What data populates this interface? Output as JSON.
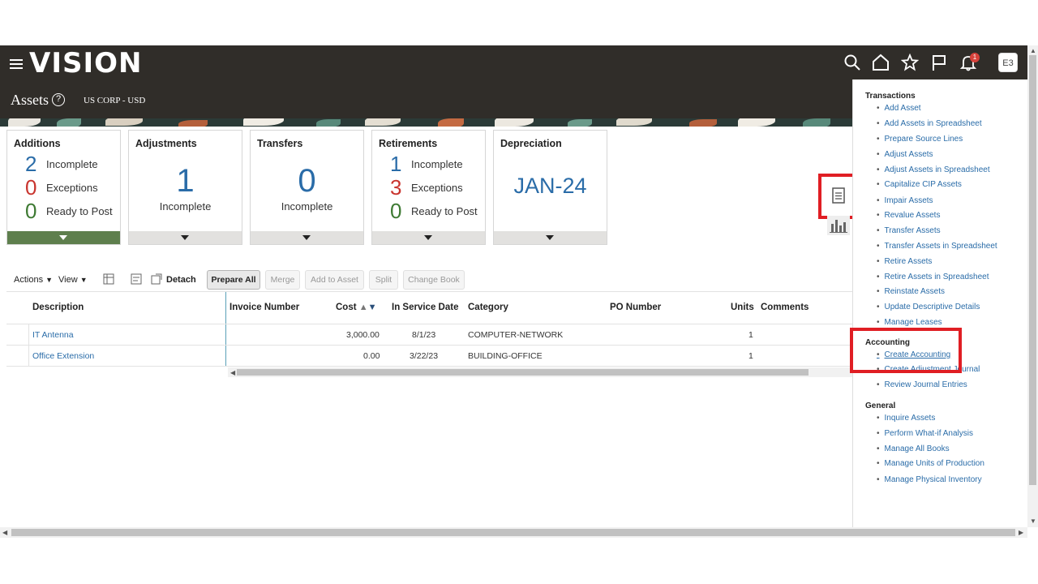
{
  "header": {
    "logo": "vision",
    "page_title": "Assets",
    "help": "?",
    "context": "US CORP - USD",
    "avatar": "E3",
    "notification_count": "1"
  },
  "cards": {
    "additions": {
      "title": "Additions",
      "rows": [
        {
          "num": "2",
          "label": "Incomplete"
        },
        {
          "num": "0",
          "label": "Exceptions"
        },
        {
          "num": "0",
          "label": "Ready to Post"
        }
      ]
    },
    "adjustments": {
      "title": "Adjustments",
      "num": "1",
      "label": "Incomplete"
    },
    "transfers": {
      "title": "Transfers",
      "num": "0",
      "label": "Incomplete"
    },
    "retirements": {
      "title": "Retirements",
      "rows": [
        {
          "num": "1",
          "label": "Incomplete"
        },
        {
          "num": "3",
          "label": "Exceptions"
        },
        {
          "num": "0",
          "label": "Ready to Post"
        }
      ]
    },
    "depreciation": {
      "title": "Depreciation",
      "period": "JAN-24"
    }
  },
  "toolbar": {
    "actions": "Actions",
    "view": "View",
    "detach": "Detach",
    "prepare_all": "Prepare All",
    "merge": "Merge",
    "add_to_asset": "Add to Asset",
    "split": "Split",
    "change_book": "Change Book"
  },
  "table": {
    "headers": {
      "description": "Description",
      "invoice": "Invoice Number",
      "cost": "Cost",
      "in_service": "In Service Date",
      "category": "Category",
      "po": "PO Number",
      "units": "Units",
      "comments": "Comments"
    },
    "rows": [
      {
        "description": "IT Antenna",
        "cost": "3,000.00",
        "date": "8/1/23",
        "category": "COMPUTER-NETWORK",
        "units": "1"
      },
      {
        "description": "Office Extension",
        "cost": "0.00",
        "date": "3/22/23",
        "category": "BUILDING-OFFICE",
        "units": "1"
      }
    ]
  },
  "panel": {
    "transactions_title": "Transactions",
    "transactions": [
      "Add Asset",
      "Add Assets in Spreadsheet",
      "Prepare Source Lines",
      "Adjust Assets",
      "Adjust Assets in Spreadsheet",
      "Capitalize CIP Assets",
      "Impair Assets",
      "Revalue Assets",
      "Transfer Assets",
      "Transfer Assets in Spreadsheet",
      "Retire Assets",
      "Retire Assets in Spreadsheet",
      "Reinstate Assets",
      "Update Descriptive Details",
      "Manage Leases"
    ],
    "accounting_title": "Accounting",
    "accounting": [
      "Create Accounting",
      "Create Adjustment Journal",
      "Review Journal Entries"
    ],
    "general_title": "General",
    "general": [
      "Inquire Assets",
      "Perform What-if Analysis",
      "Manage All Books",
      "Manage Units of Production",
      "Manage Physical Inventory"
    ]
  },
  "colors": {
    "header_bg": "#302d29",
    "link": "#2a6ca8",
    "highlight": "#e01e24",
    "additions_foot": "#5e7f4d"
  }
}
